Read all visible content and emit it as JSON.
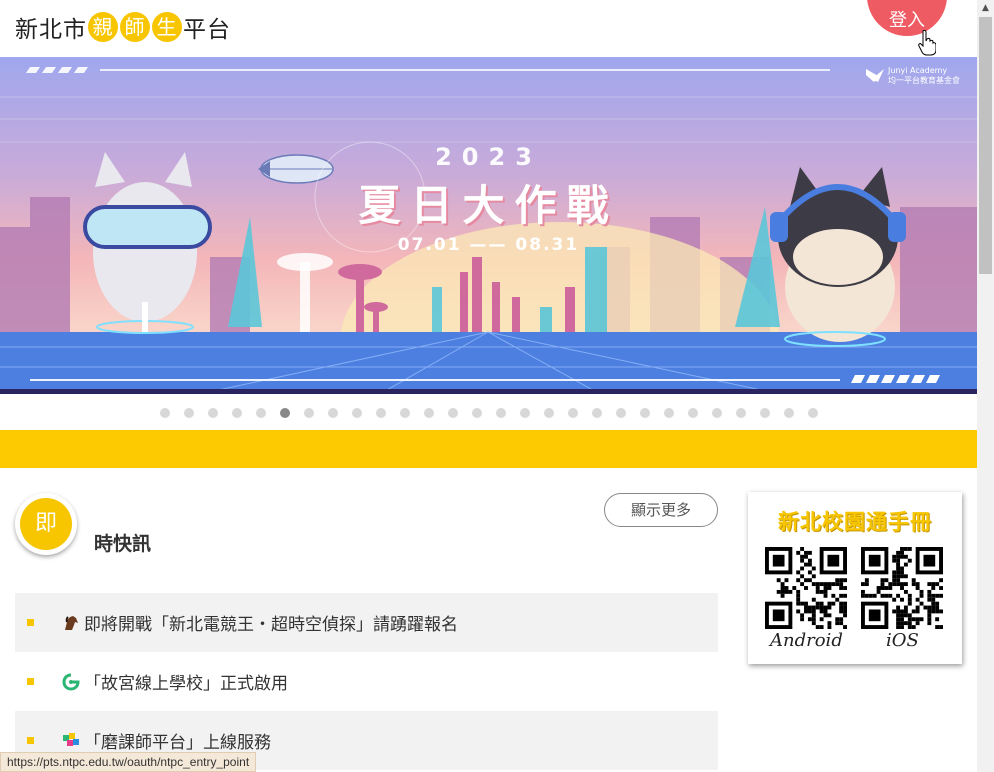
{
  "header": {
    "logo_prefix": "新北市",
    "logo_circled": [
      "親",
      "師",
      "生"
    ],
    "logo_suffix": "平台",
    "login_label": "登入"
  },
  "banner": {
    "year": "2023",
    "title": "夏日大作戰",
    "date_range": "07.01 —— 08.31",
    "brand_line1": "Junyi Academy",
    "brand_line2": "均一平台教育基金會"
  },
  "carousel": {
    "total_dots": 28,
    "active_index": 5
  },
  "news": {
    "icon_char": "即",
    "title": "時快訊",
    "more_label": "顯示更多",
    "items": [
      {
        "icon": "horse-icon",
        "text": "即將開戰「新北電競王・超時空偵探」請踴躍報名"
      },
      {
        "icon": "leaf-logo-icon",
        "text": "「故宮線上學校」正式啟用"
      },
      {
        "icon": "colorful-logo-icon",
        "text": "「磨課師平台」上線服務"
      }
    ]
  },
  "qr_card": {
    "title": "新北校園通手冊",
    "android_label": "Android",
    "ios_label": "iOS"
  },
  "status_bar": {
    "url": "https://pts.ntpc.edu.tw/oauth/ntpc_entry_point"
  },
  "colors": {
    "accent_yellow": "#fdc900",
    "login_red": "#ef5b62"
  }
}
